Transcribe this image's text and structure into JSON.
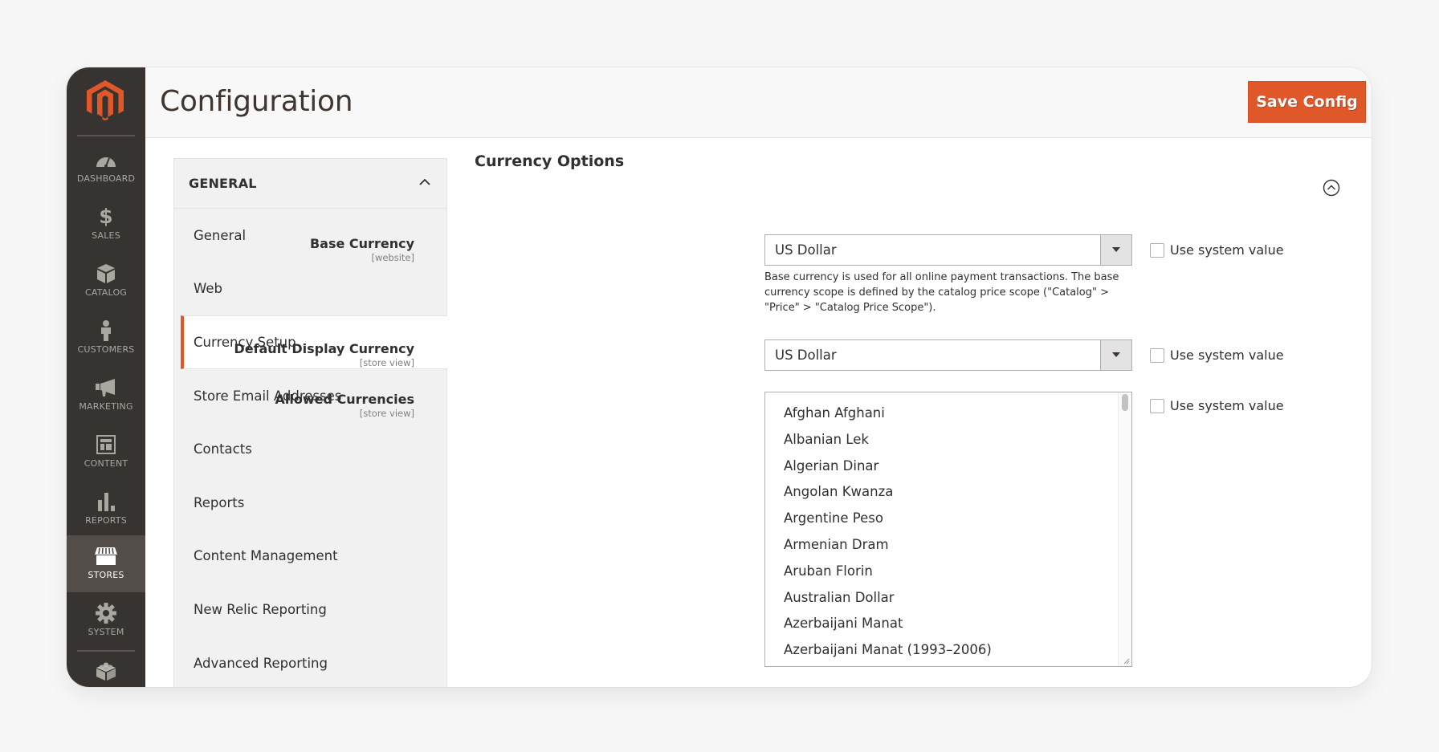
{
  "brand": {
    "accent": "#e0582a",
    "sidebar_bg": "#373330",
    "logo": "magento-logo-icon"
  },
  "sidebar": {
    "items": [
      {
        "label": "DASHBOARD",
        "icon": "dashboard-icon",
        "active": false
      },
      {
        "label": "SALES",
        "icon": "dollar-icon",
        "active": false
      },
      {
        "label": "CATALOG",
        "icon": "box-icon",
        "active": false
      },
      {
        "label": "CUSTOMERS",
        "icon": "person-icon",
        "active": false
      },
      {
        "label": "MARKETING",
        "icon": "megaphone-icon",
        "active": false
      },
      {
        "label": "CONTENT",
        "icon": "layout-icon",
        "active": false
      },
      {
        "label": "REPORTS",
        "icon": "bar-chart-icon",
        "active": false
      },
      {
        "label": "STORES",
        "icon": "storefront-icon",
        "active": true
      },
      {
        "label": "SYSTEM",
        "icon": "gear-icon",
        "active": false
      }
    ],
    "extensions_icon": "lego-brick-icon"
  },
  "header": {
    "title": "Configuration",
    "save_label": "Save Config"
  },
  "config_nav": {
    "group_title": "GENERAL",
    "group_expanded": true,
    "items": [
      {
        "label": "General",
        "active": false
      },
      {
        "label": "Web",
        "active": false
      },
      {
        "label": "Currency Setup",
        "active": true
      },
      {
        "label": "Store Email Addresses",
        "active": false
      },
      {
        "label": "Contacts",
        "active": false
      },
      {
        "label": "Reports",
        "active": false
      },
      {
        "label": "Content Management",
        "active": false
      },
      {
        "label": "New Relic Reporting",
        "active": false
      },
      {
        "label": "Advanced Reporting",
        "active": false
      }
    ]
  },
  "section": {
    "title": "Currency Options",
    "collapse_icon": "chevron-up-circle-icon",
    "fields": {
      "base_currency": {
        "label": "Base Currency",
        "scope": "[website]",
        "value": "US Dollar",
        "note": "Base currency is used for all online payment transactions. The base currency scope is defined by the catalog price scope (\"Catalog\" > \"Price\" > \"Catalog Price Scope\").",
        "use_system_value_label": "Use system value",
        "use_system_value": false
      },
      "default_display_currency": {
        "label": "Default Display Currency",
        "scope": "[store view]",
        "value": "US Dollar",
        "use_system_value_label": "Use system value",
        "use_system_value": false
      },
      "allowed_currencies": {
        "label": "Allowed Currencies",
        "scope": "[store view]",
        "options": [
          "Afghan Afghani",
          "Albanian Lek",
          "Algerian Dinar",
          "Angolan Kwanza",
          "Argentine Peso",
          "Armenian Dram",
          "Aruban Florin",
          "Australian Dollar",
          "Azerbaijani Manat",
          "Azerbaijani Manat (1993–2006)"
        ],
        "use_system_value_label": "Use system value",
        "use_system_value": false
      }
    }
  }
}
